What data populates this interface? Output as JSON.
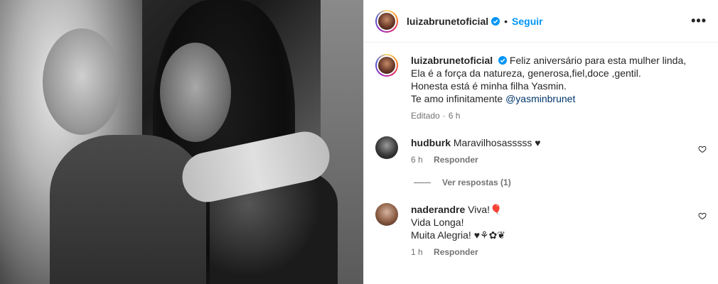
{
  "post": {
    "author": "luizabrunetoficial",
    "follow_label": "Seguir",
    "separator": "•",
    "more_label": "•••",
    "caption_lines": [
      "Feliz aniversário para esta mulher linda,",
      "Ela é a força da natureza, generosa,fiel,doce ,gentil.",
      "Honesta está é minha filha Yasmin.",
      "Te amo infinitamente "
    ],
    "caption_mention": "@yasminbrunet",
    "edited_label": "Editado",
    "time_separator": "·",
    "caption_time": "6 h"
  },
  "comments": [
    {
      "user": "hudburk",
      "text": "Maravilhosasssss ♥",
      "time": "6 h",
      "reply_label": "Responder",
      "view_replies": "Ver respostas (1)"
    },
    {
      "user": "naderandre",
      "lines": [
        "Viva!🎈",
        "Vida Longa!",
        "Muita Alegria! ♥⚘✿❦"
      ],
      "time": "1 h",
      "reply_label": "Responder"
    }
  ],
  "colors": {
    "accent": "#0095f6",
    "mention": "#00376b",
    "muted": "#737373"
  },
  "icons": [
    "verified-badge-icon",
    "more-options-icon",
    "heart-outline-icon"
  ]
}
